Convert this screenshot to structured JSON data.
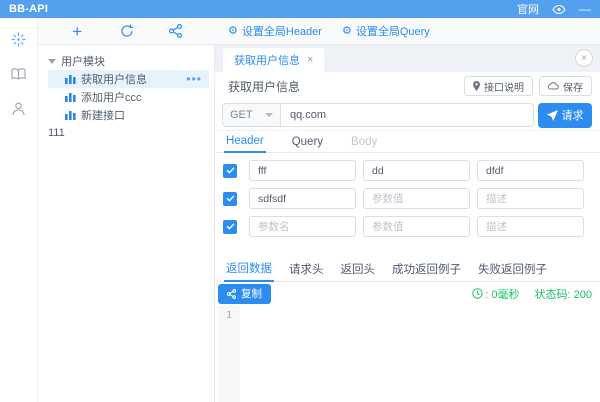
{
  "titlebar": {
    "app_name": "BB-API",
    "website": "官网"
  },
  "toolbar": {
    "set_global_header": "设置全局Header",
    "set_global_query": "设置全局Query"
  },
  "tree": {
    "root_label": "用户模块",
    "items": [
      {
        "label": "获取用户信息",
        "selected": true
      },
      {
        "label": "添加用户ccc",
        "selected": false
      },
      {
        "label": "新建接口",
        "selected": false
      }
    ],
    "orphan_label": "111",
    "more_glyph": "•••"
  },
  "main": {
    "tab_label": "获取用户信息",
    "close_glyph": "×",
    "page_title": "获取用户信息",
    "doc_button": "接口说明",
    "save_button": "保存",
    "request": {
      "method": "GET",
      "url": "qq.com",
      "send_label": "请求"
    },
    "param_tabs": [
      "Header",
      "Query",
      "Body"
    ],
    "placeholders": {
      "name": "参数名",
      "value": "参数值",
      "desc": "描述"
    },
    "rows": [
      {
        "name": "fff",
        "value": "dd",
        "desc": "dfdf"
      },
      {
        "name": "sdfsdf",
        "value": "",
        "desc": ""
      },
      {
        "name": "",
        "value": "",
        "desc": ""
      }
    ],
    "response_tabs": [
      "返回数据",
      "请求头",
      "返回头",
      "成功返回例子",
      "失败返回例子"
    ],
    "copy_button": "复制",
    "status": {
      "duration_text": ": 0毫秒",
      "code_text": "状态码: 200"
    },
    "editor_line": "1"
  },
  "colors": {
    "primary": "#2d8cf0",
    "titlebar_bg": "#52a0ee",
    "success": "#19be6b",
    "selected_row_bg": "#e6f2fc",
    "toolbar_bg": "#f7f9fb",
    "tabbar_bg": "#eef2f6"
  }
}
